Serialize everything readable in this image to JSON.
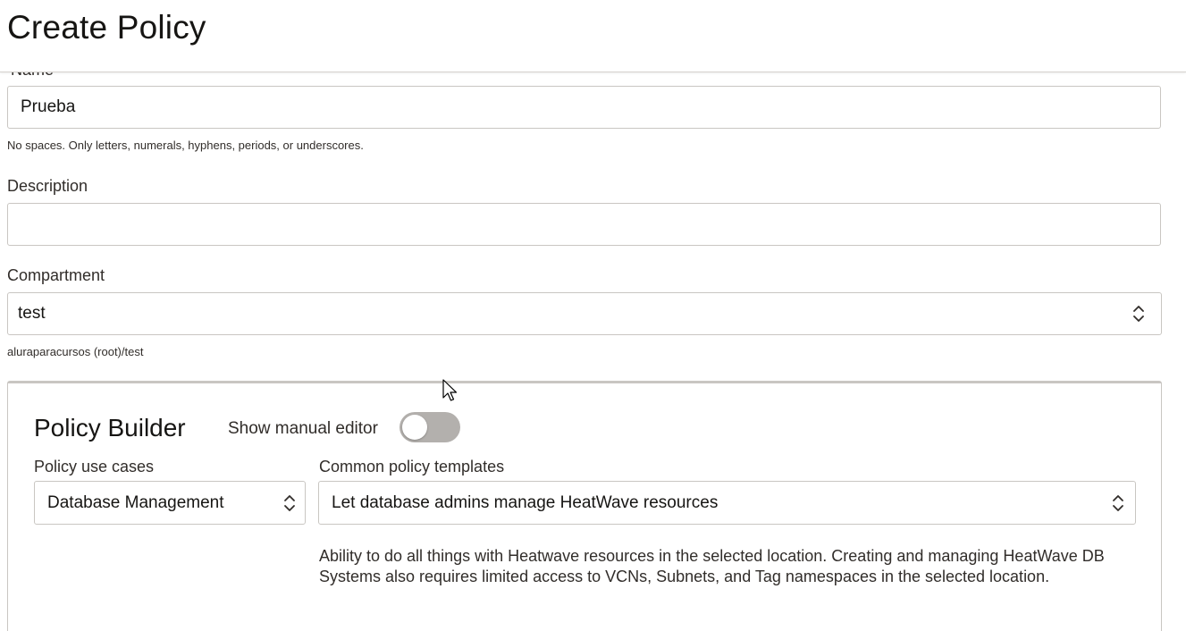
{
  "header": {
    "title": "Create Policy"
  },
  "form": {
    "name": {
      "label": "Name",
      "value": "Prueba",
      "helper": "No spaces. Only letters, numerals, hyphens, periods, or underscores."
    },
    "description": {
      "label": "Description",
      "value": ""
    },
    "compartment": {
      "label": "Compartment",
      "value": "test",
      "path": "aluraparacursos (root)/test"
    }
  },
  "policy_builder": {
    "title": "Policy Builder",
    "manual_editor_label": "Show manual editor",
    "manual_editor_on": false,
    "use_cases": {
      "label": "Policy use cases",
      "selected": "Database Management"
    },
    "templates": {
      "label": "Common policy templates",
      "selected": "Let database admins manage HeatWave resources"
    },
    "template_description": "Ability to do all things with Heatwave resources in the selected location. Creating and managing HeatWave DB Systems also requires limited access to VCNs, Subnets, and Tag namespaces in the selected location."
  },
  "icons": {
    "select_chevron": "chevron-up-down-icon",
    "cursor": "mouse-pointer-icon"
  },
  "colors": {
    "border": "#c9c6c2",
    "text": "#161513",
    "toggle_off": "#b3b0ad"
  }
}
